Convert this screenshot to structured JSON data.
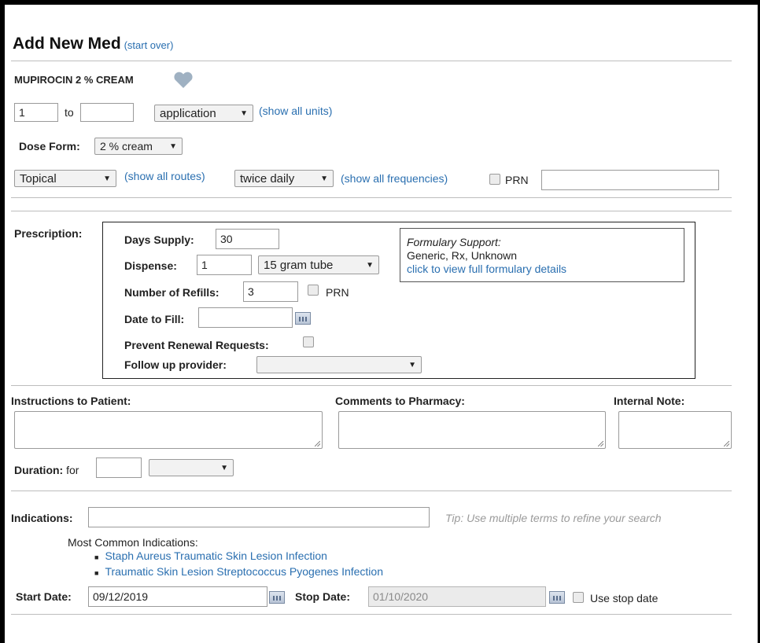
{
  "header": {
    "title": "Add New Med",
    "start_over": "(start over)"
  },
  "med": {
    "name": "MUPIROCIN 2 % CREAM",
    "favorite_icon": "heart-icon"
  },
  "dose": {
    "from_value": "1",
    "to_label": "to",
    "to_value": "",
    "unit": "application",
    "show_units": "(show all units)",
    "dose_form_label": "Dose Form:",
    "dose_form": "2 % cream"
  },
  "route": {
    "route": "Topical",
    "show_routes": "(show all routes)",
    "frequency": "twice daily",
    "show_frequencies": "(show all frequencies)",
    "prn_label": "PRN",
    "prn_value": ""
  },
  "prescription": {
    "label": "Prescription:",
    "days_supply_label": "Days Supply:",
    "days_supply": "30",
    "dispense_label": "Dispense:",
    "dispense_qty": "1",
    "dispense_unit": "15 gram tube",
    "refills_label": "Number of Refills:",
    "refills": "3",
    "refills_prn": "PRN",
    "date_to_fill_label": "Date to Fill:",
    "date_to_fill": "",
    "prevent_renewal_label": "Prevent Renewal Requests:",
    "follow_up_label": "Follow up provider:",
    "follow_up_value": "",
    "formulary": {
      "title": "Formulary Support:",
      "status": "Generic, Rx, Unknown",
      "details_link": "click to view full formulary details"
    }
  },
  "notes": {
    "instructions_label": "Instructions to Patient:",
    "comments_label": "Comments to Pharmacy:",
    "internal_label": "Internal Note:",
    "duration_label": "Duration:",
    "duration_for": "for",
    "duration_value": "",
    "duration_unit": ""
  },
  "indications": {
    "label": "Indications:",
    "value": "",
    "tip": "Tip: Use multiple terms to refine your search",
    "common_label": "Most Common Indications:",
    "common": [
      "Staph Aureus Traumatic Skin Lesion Infection",
      "Traumatic Skin Lesion Streptococcus Pyogenes Infection"
    ]
  },
  "dates": {
    "start_label": "Start Date:",
    "start_value": "09/12/2019",
    "stop_label": "Stop Date:",
    "stop_value": "01/10/2020",
    "use_stop_label": "Use stop date"
  },
  "colors": {
    "link": "#2a6fb0",
    "border": "#bdbdbd",
    "favorite": "#9fb1c2"
  }
}
